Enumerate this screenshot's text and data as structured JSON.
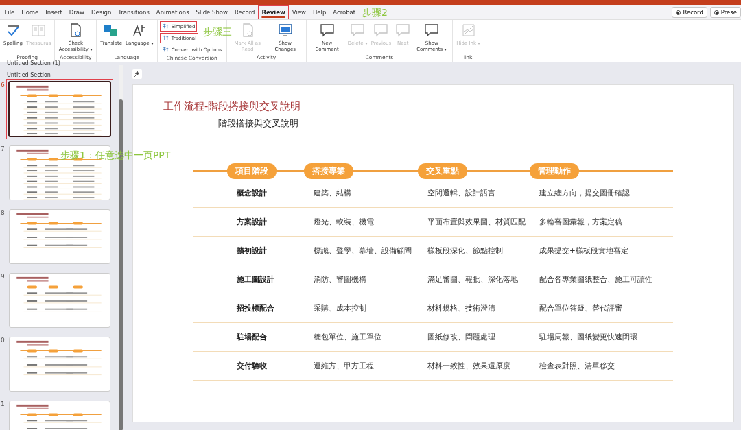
{
  "tabs": [
    {
      "label": "File",
      "selected": false,
      "highlighted": false
    },
    {
      "label": "Home",
      "selected": false,
      "highlighted": false
    },
    {
      "label": "Insert",
      "selected": false,
      "highlighted": false
    },
    {
      "label": "Draw",
      "selected": false,
      "highlighted": false
    },
    {
      "label": "Design",
      "selected": false,
      "highlighted": false
    },
    {
      "label": "Transitions",
      "selected": false,
      "highlighted": false
    },
    {
      "label": "Animations",
      "selected": false,
      "highlighted": false
    },
    {
      "label": "Slide Show",
      "selected": false,
      "highlighted": false
    },
    {
      "label": "Record",
      "selected": false,
      "highlighted": false
    },
    {
      "label": "Review",
      "selected": true,
      "highlighted": true
    },
    {
      "label": "View",
      "selected": false,
      "highlighted": false
    },
    {
      "label": "Help",
      "selected": false,
      "highlighted": false
    },
    {
      "label": "Acrobat",
      "selected": false,
      "highlighted": false
    }
  ],
  "top_buttons": [
    "Record",
    "Prese"
  ],
  "ribbon": [
    {
      "label": "Proofing",
      "buttons": [
        {
          "label": "Spelling",
          "kind": "large",
          "disabled": false,
          "dropdown": false,
          "highlighted": false
        },
        {
          "label": "Thesaurus",
          "kind": "large",
          "disabled": true,
          "dropdown": false,
          "highlighted": false
        }
      ]
    },
    {
      "label": "Accessibility",
      "buttons": [
        {
          "label": "Check Accessibility",
          "kind": "large",
          "disabled": false,
          "dropdown": true,
          "highlighted": false
        }
      ]
    },
    {
      "label": "Language",
      "buttons": [
        {
          "label": "Translate",
          "kind": "large",
          "disabled": false,
          "dropdown": false,
          "highlighted": false
        },
        {
          "label": "Language",
          "kind": "large",
          "disabled": false,
          "dropdown": true,
          "highlighted": false
        }
      ]
    },
    {
      "label": "Chinese Conversion",
      "buttons": [
        {
          "label": "Simplified",
          "kind": "small",
          "disabled": false,
          "highlighted": true
        },
        {
          "label": "Traditional",
          "kind": "small",
          "disabled": false,
          "highlighted": true
        },
        {
          "label": "Convert with Options",
          "kind": "small",
          "disabled": false,
          "highlighted": false
        }
      ]
    },
    {
      "label": "Activity",
      "buttons": [
        {
          "label": "Mark All as Read",
          "kind": "large",
          "disabled": true,
          "dropdown": false,
          "highlighted": false
        },
        {
          "label": "Show Changes",
          "kind": "large",
          "disabled": false,
          "dropdown": false,
          "highlighted": false
        }
      ]
    },
    {
      "label": "Comments",
      "buttons": [
        {
          "label": "New Comment",
          "kind": "large",
          "disabled": false,
          "dropdown": false,
          "highlighted": false
        },
        {
          "label": "Delete",
          "kind": "large",
          "disabled": true,
          "dropdown": true,
          "highlighted": false
        },
        {
          "label": "Previous",
          "kind": "large",
          "disabled": true,
          "dropdown": false,
          "highlighted": false
        },
        {
          "label": "Next",
          "kind": "large",
          "disabled": true,
          "dropdown": false,
          "highlighted": false
        },
        {
          "label": "Show Comments",
          "kind": "large",
          "disabled": false,
          "dropdown": true,
          "highlighted": false
        }
      ]
    },
    {
      "label": "Ink",
      "buttons": [
        {
          "label": "Hide Ink",
          "kind": "large",
          "disabled": true,
          "dropdown": true,
          "highlighted": false
        }
      ]
    }
  ],
  "sections": [
    "Untitled Section (1)",
    "Untitled Section"
  ],
  "thumbnails": [
    {
      "number": "6",
      "selected": true,
      "highlighted": true
    },
    {
      "number": "7",
      "selected": false,
      "highlighted": false
    },
    {
      "number": "8",
      "selected": false,
      "highlighted": false
    },
    {
      "number": "9",
      "selected": false,
      "highlighted": false
    },
    {
      "number": "0",
      "selected": false,
      "highlighted": false
    },
    {
      "number": "1",
      "selected": false,
      "highlighted": false
    }
  ],
  "annotations": [
    "步骤2",
    "步骤三",
    "步骤1：任意选中一页PPT"
  ],
  "slide": {
    "title": "工作流程-階段搭接與交叉說明",
    "subtitle": "階段搭接與交叉說明",
    "headers": [
      "項目階段",
      "搭接專業",
      "交叉重點",
      "管理動作"
    ],
    "rows": [
      [
        "概念設計",
        "建築、結構",
        "空間邏輯、設計語言",
        "建立總方向，提交圖冊確認"
      ],
      [
        "方案設計",
        "燈光、軟裝、機電",
        "平面布置與效果圖、材質匹配",
        "多輪審圖彙報，方案定稿"
      ],
      [
        "擴初設計",
        "標識、聲學、幕墻、設備顧問",
        "樣板段深化、節點控制",
        "成果提交+樣板段實地審定"
      ],
      [
        "施工圖設計",
        "消防、審圖機構",
        "滿足審圖、報批、深化落地",
        "配合各專業圖紙整合、施工可讀性"
      ],
      [
        "招投標配合",
        "采購、成本控制",
        "材料規格、技術澄清",
        "配合單位答疑、替代評審"
      ],
      [
        "駐場配合",
        "總包單位、施工單位",
        "圖紙修改、問題處理",
        "駐場周報、圖紙變更快速閉環"
      ],
      [
        "交付驗收",
        "運維方、甲方工程",
        "材料一致性、效果還原度",
        "檢查表對照、清單移交"
      ]
    ]
  }
}
